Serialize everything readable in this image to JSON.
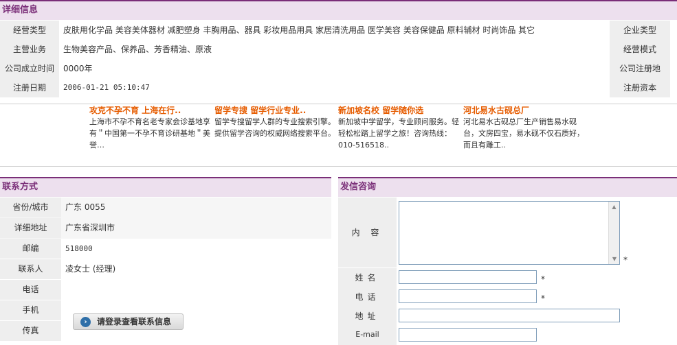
{
  "detail": {
    "title": "详细信息",
    "rows_left": [
      {
        "label": "经营类型",
        "value": "皮肤用化学品 美容美体器材 减肥塑身 丰胸用品、器具 彩妆用品用具 家居清洗用品 医学美容 美容保健品 原料辅材 时尚饰品 其它"
      },
      {
        "label": "主营业务",
        "value": "生物美容产品、保养品、芳香精油、原液"
      },
      {
        "label": "公司成立时间",
        "value": "0000年"
      },
      {
        "label": "注册日期",
        "value": "2006-01-21 05:10:47"
      }
    ],
    "rows_right": [
      "企业类型",
      "经营模式",
      "公司注册地",
      "注册资本"
    ]
  },
  "ads": [
    {
      "title": "攻克不孕不育 上海在行..",
      "text": "上海市不孕不育名老专家会诊基地享有＂中国第一不孕不育诊研基地＂美誉…"
    },
    {
      "title": "留学专搜 留学行业专业..",
      "text": "留学专搜留学人群的专业搜索引擎。提供留学咨询的权威网络搜索平台。"
    },
    {
      "title": "新加坡名校 留学随你选",
      "text": "新加坡中学留学，专业顾问服务。轻轻松松踏上留学之旅！咨询热线：010-516518.."
    },
    {
      "title": "河北易水古砚总厂",
      "text": "河北易水古砚总厂生产销售易水砚台，文房四宝，易水砚不仅石质好，而且有雕工.."
    }
  ],
  "contact": {
    "title": "联系方式",
    "rows": [
      {
        "label": "省份/城市",
        "value": "广东 0055"
      },
      {
        "label": "详细地址",
        "value": "广东省深圳市"
      },
      {
        "label": "邮编",
        "value": "518000"
      },
      {
        "label": "联系人",
        "value": "凌女士 (经理)"
      },
      {
        "label": "电话",
        "value": ""
      },
      {
        "label": "手机",
        "value": ""
      },
      {
        "label": "传真",
        "value": ""
      }
    ],
    "login_button": "请登录查看联系信息"
  },
  "inquiry": {
    "title": "发信咨询",
    "content_label": "内 容",
    "name_label": "姓名",
    "phone_label": "电话",
    "address_label": "地址",
    "email_label": "E-mail",
    "required_mark": "*"
  }
}
